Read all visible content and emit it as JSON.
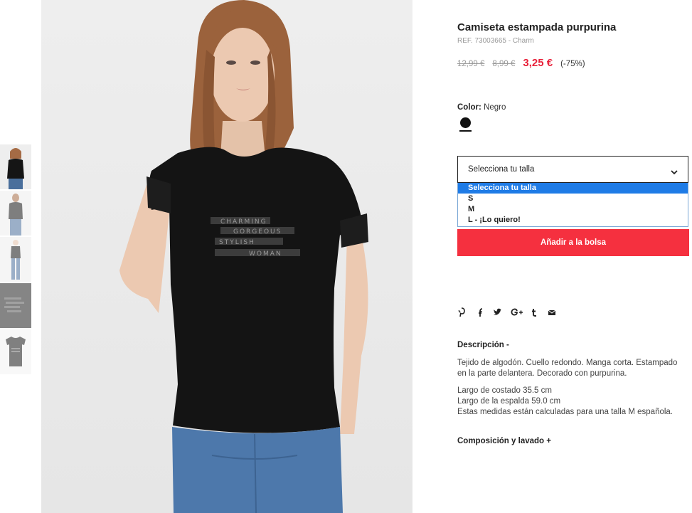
{
  "product": {
    "title": "Camiseta estampada purpurina",
    "ref": "REF. 73003665 - Charm",
    "price_original": "12,99 €",
    "price_previous": "8,99 €",
    "price_sale": "3,25 €",
    "discount": "(-75%)"
  },
  "color": {
    "label": "Color:",
    "value": "Negro",
    "swatch": "#111111"
  },
  "size": {
    "placeholder": "Selecciona tu talla",
    "options": [
      "Selecciona tu talla",
      "S",
      "M",
      "L - ¡Lo quiero!"
    ]
  },
  "actions": {
    "add_to_bag": "Añadir a la bolsa"
  },
  "social_icons": [
    "pinterest-icon",
    "facebook-icon",
    "twitter-icon",
    "google-plus-icon",
    "tumblr-icon",
    "email-icon"
  ],
  "description": {
    "heading": "Descripción  -",
    "line1": "Tejido de algodón. Cuello redondo. Manga corta. Estampado",
    "line2": "en la parte delantera. Decorado con purpurina.",
    "line3": "Largo de costado 35.5 cm",
    "line4": "Largo de la espalda 59.0 cm",
    "line5": "Estas medidas están calculadas para una talla M española."
  },
  "composition": {
    "heading": "Composición y lavado  +"
  },
  "print_text": [
    "CHARMING",
    "GORGEOUS",
    "STYLISH",
    "WOMAN"
  ],
  "colors": {
    "accent": "#f5303f",
    "sale_price": "#e8213a",
    "dropdown_highlight": "#1e7be6"
  }
}
